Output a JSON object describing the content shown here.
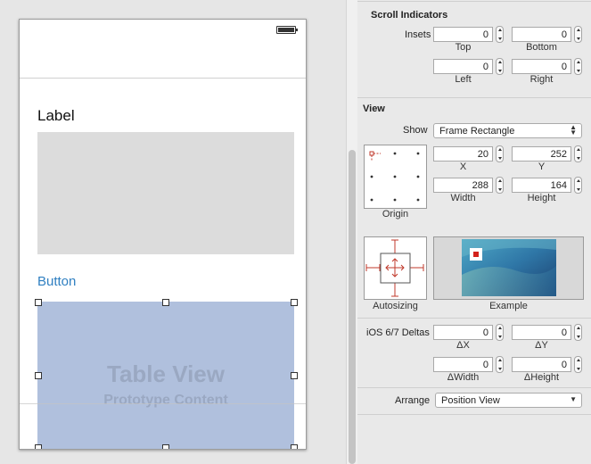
{
  "canvas": {
    "label_text": "Label",
    "button_text": "Button",
    "table_view": {
      "title": "Table View",
      "subtitle": "Prototype Content"
    }
  },
  "inspector": {
    "scroll_indicators": {
      "header": "Scroll Indicators",
      "insets_label": "Insets",
      "top": {
        "value": "0",
        "caption": "Top"
      },
      "bottom": {
        "value": "0",
        "caption": "Bottom"
      },
      "left": {
        "value": "0",
        "caption": "Left"
      },
      "right": {
        "value": "0",
        "caption": "Right"
      }
    },
    "view": {
      "header": "View",
      "show_label": "Show",
      "show_value": "Frame Rectangle",
      "x": {
        "value": "20",
        "caption": "X"
      },
      "y": {
        "value": "252",
        "caption": "Y"
      },
      "width": {
        "value": "288",
        "caption": "Width"
      },
      "height": {
        "value": "164",
        "caption": "Height"
      },
      "origin_caption": "Origin",
      "autosizing_caption": "Autosizing",
      "example_caption": "Example"
    },
    "deltas": {
      "label": "iOS 6/7 Deltas",
      "dx": {
        "value": "0",
        "caption": "ΔX"
      },
      "dy": {
        "value": "0",
        "caption": "ΔY"
      },
      "dwidth": {
        "value": "0",
        "caption": "ΔWidth"
      },
      "dheight": {
        "value": "0",
        "caption": "ΔHeight"
      }
    },
    "arrange": {
      "label": "Arrange",
      "value": "Position View"
    }
  },
  "icons": [
    "battery-icon",
    "stepper-icon",
    "popup-arrows-icon",
    "origin-selector-icon",
    "autosizing-strut-icon",
    "example-thumbnail-icon"
  ],
  "colors": {
    "accent_blue": "#2f7fc1",
    "table_view_fill": "#b0c0dd",
    "autosizing_red": "#c0392b",
    "gray_view_fill": "#dcdcdc"
  }
}
